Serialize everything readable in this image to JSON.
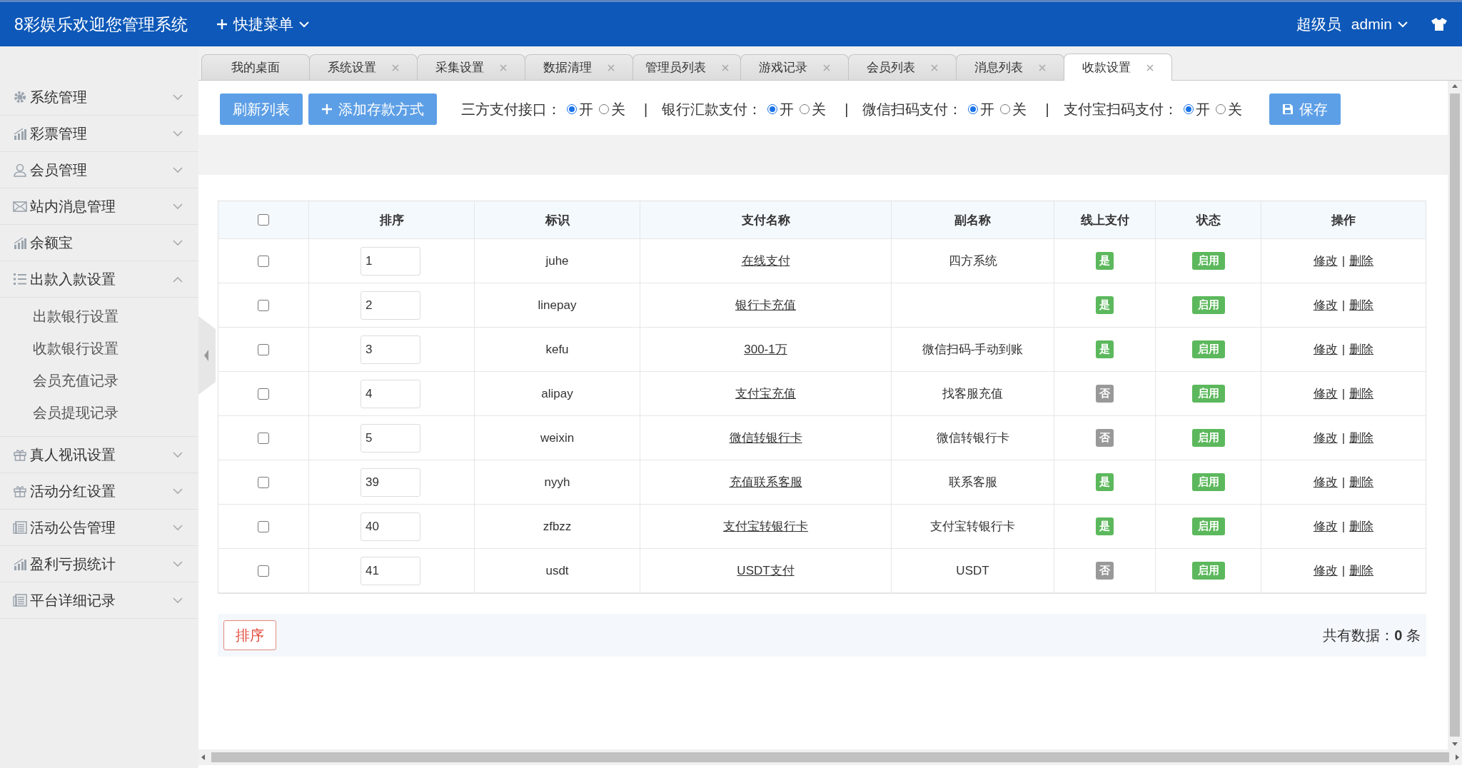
{
  "header": {
    "title": "8彩娱乐欢迎您管理系统",
    "quick_menu": "快捷菜单",
    "role": "超级员",
    "user": "admin"
  },
  "sidebar": {
    "items": [
      {
        "label": "系统管理",
        "kind": "gear",
        "expanded": false
      },
      {
        "label": "彩票管理",
        "kind": "chart",
        "expanded": false
      },
      {
        "label": "会员管理",
        "kind": "user",
        "expanded": false
      },
      {
        "label": "站内消息管理",
        "kind": "mail",
        "expanded": false
      },
      {
        "label": "余额宝",
        "kind": "chart",
        "expanded": false
      },
      {
        "label": "出款入款设置",
        "kind": "list",
        "expanded": true,
        "children": [
          {
            "label": "出款银行设置"
          },
          {
            "label": "收款银行设置"
          },
          {
            "label": "会员充值记录"
          },
          {
            "label": "会员提现记录"
          }
        ]
      },
      {
        "label": "真人视讯设置",
        "kind": "gift",
        "expanded": false
      },
      {
        "label": "活动分红设置",
        "kind": "gift",
        "expanded": false
      },
      {
        "label": "活动公告管理",
        "kind": "doc",
        "expanded": false
      },
      {
        "label": "盈利亏损统计",
        "kind": "chart",
        "expanded": false
      },
      {
        "label": "平台详细记录",
        "kind": "doc",
        "expanded": false
      }
    ]
  },
  "tabs": [
    {
      "label": "我的桌面",
      "closable": false,
      "selected": false
    },
    {
      "label": "系统设置",
      "closable": true,
      "selected": false
    },
    {
      "label": "采集设置",
      "closable": true,
      "selected": false
    },
    {
      "label": "数据清理",
      "closable": true,
      "selected": false
    },
    {
      "label": "管理员列表",
      "closable": true,
      "selected": false
    },
    {
      "label": "游戏记录",
      "closable": true,
      "selected": false
    },
    {
      "label": "会员列表",
      "closable": true,
      "selected": false
    },
    {
      "label": "消息列表",
      "closable": true,
      "selected": false
    },
    {
      "label": "收款设置",
      "closable": true,
      "selected": true
    }
  ],
  "toolbar": {
    "buttons": [
      {
        "label": "刷新列表",
        "kind": "plain"
      },
      {
        "label": "添加存款方式",
        "kind": "add"
      }
    ],
    "switches": [
      {
        "label": "三方支付接口：",
        "on_label": "开",
        "off_label": "关",
        "on": true
      },
      {
        "separator": "|",
        "label": "银行汇款支付：",
        "on_label": "开",
        "off_label": "关",
        "on": true
      },
      {
        "separator": "|",
        "label": "微信扫码支付：",
        "on_label": "开",
        "off_label": "关",
        "on": true
      },
      {
        "separator": "|",
        "label": "支付宝扫码支付：",
        "on_label": "开",
        "off_label": "关",
        "on": true
      }
    ],
    "save": "保存"
  },
  "table": {
    "select_all_checked": false,
    "columns": [
      "排序",
      "标识",
      "支付名称",
      "副名称",
      "线上支付",
      "状态",
      "操作"
    ],
    "rows": [
      {
        "checked": false,
        "order": "1",
        "code": "juhe",
        "name": "在线支付",
        "subname": "四方系统",
        "online": "是",
        "online_on": true,
        "status": "启用",
        "actions": [
          "修改",
          "删除"
        ],
        "action_separator": "|"
      },
      {
        "checked": false,
        "order": "2",
        "code": "linepay",
        "name": "银行卡充值",
        "online": "是",
        "online_on": true,
        "status": "启用",
        "actions": [
          "修改",
          "删除"
        ],
        "action_separator": "|"
      },
      {
        "checked": false,
        "order": "3",
        "code": "kefu",
        "name": "300-1万",
        "subname": "微信扫码-手动到账",
        "online": "是",
        "online_on": true,
        "status": "启用",
        "actions": [
          "修改",
          "删除"
        ],
        "action_separator": "|"
      },
      {
        "checked": false,
        "order": "4",
        "code": "alipay",
        "name": "支付宝充值",
        "subname": "找客服充值",
        "online": "否",
        "online_on": false,
        "status": "启用",
        "actions": [
          "修改",
          "删除"
        ],
        "action_separator": "|"
      },
      {
        "checked": false,
        "order": "5",
        "code": "weixin",
        "name": "微信转银行卡",
        "subname": "微信转银行卡",
        "online": "否",
        "online_on": false,
        "status": "启用",
        "actions": [
          "修改",
          "删除"
        ],
        "action_separator": "|"
      },
      {
        "checked": false,
        "order": "39",
        "code": "nyyh",
        "name": "充值联系客服",
        "subname": "联系客服",
        "online": "是",
        "online_on": true,
        "status": "启用",
        "actions": [
          "修改",
          "删除"
        ],
        "action_separator": "|"
      },
      {
        "checked": false,
        "order": "40",
        "code": "zfbzz",
        "name": "支付宝转银行卡",
        "subname": "支付宝转银行卡",
        "online": "是",
        "online_on": true,
        "status": "启用",
        "actions": [
          "修改",
          "删除"
        ],
        "action_separator": "|"
      },
      {
        "checked": false,
        "order": "41",
        "code": "usdt",
        "name": "USDT支付",
        "subname": "USDT",
        "online": "否",
        "online_on": false,
        "status": "启用",
        "actions": [
          "修改",
          "删除"
        ],
        "action_separator": "|"
      }
    ]
  },
  "footer": {
    "sort_button": "排序",
    "total": "共有数据：**0** 条"
  }
}
